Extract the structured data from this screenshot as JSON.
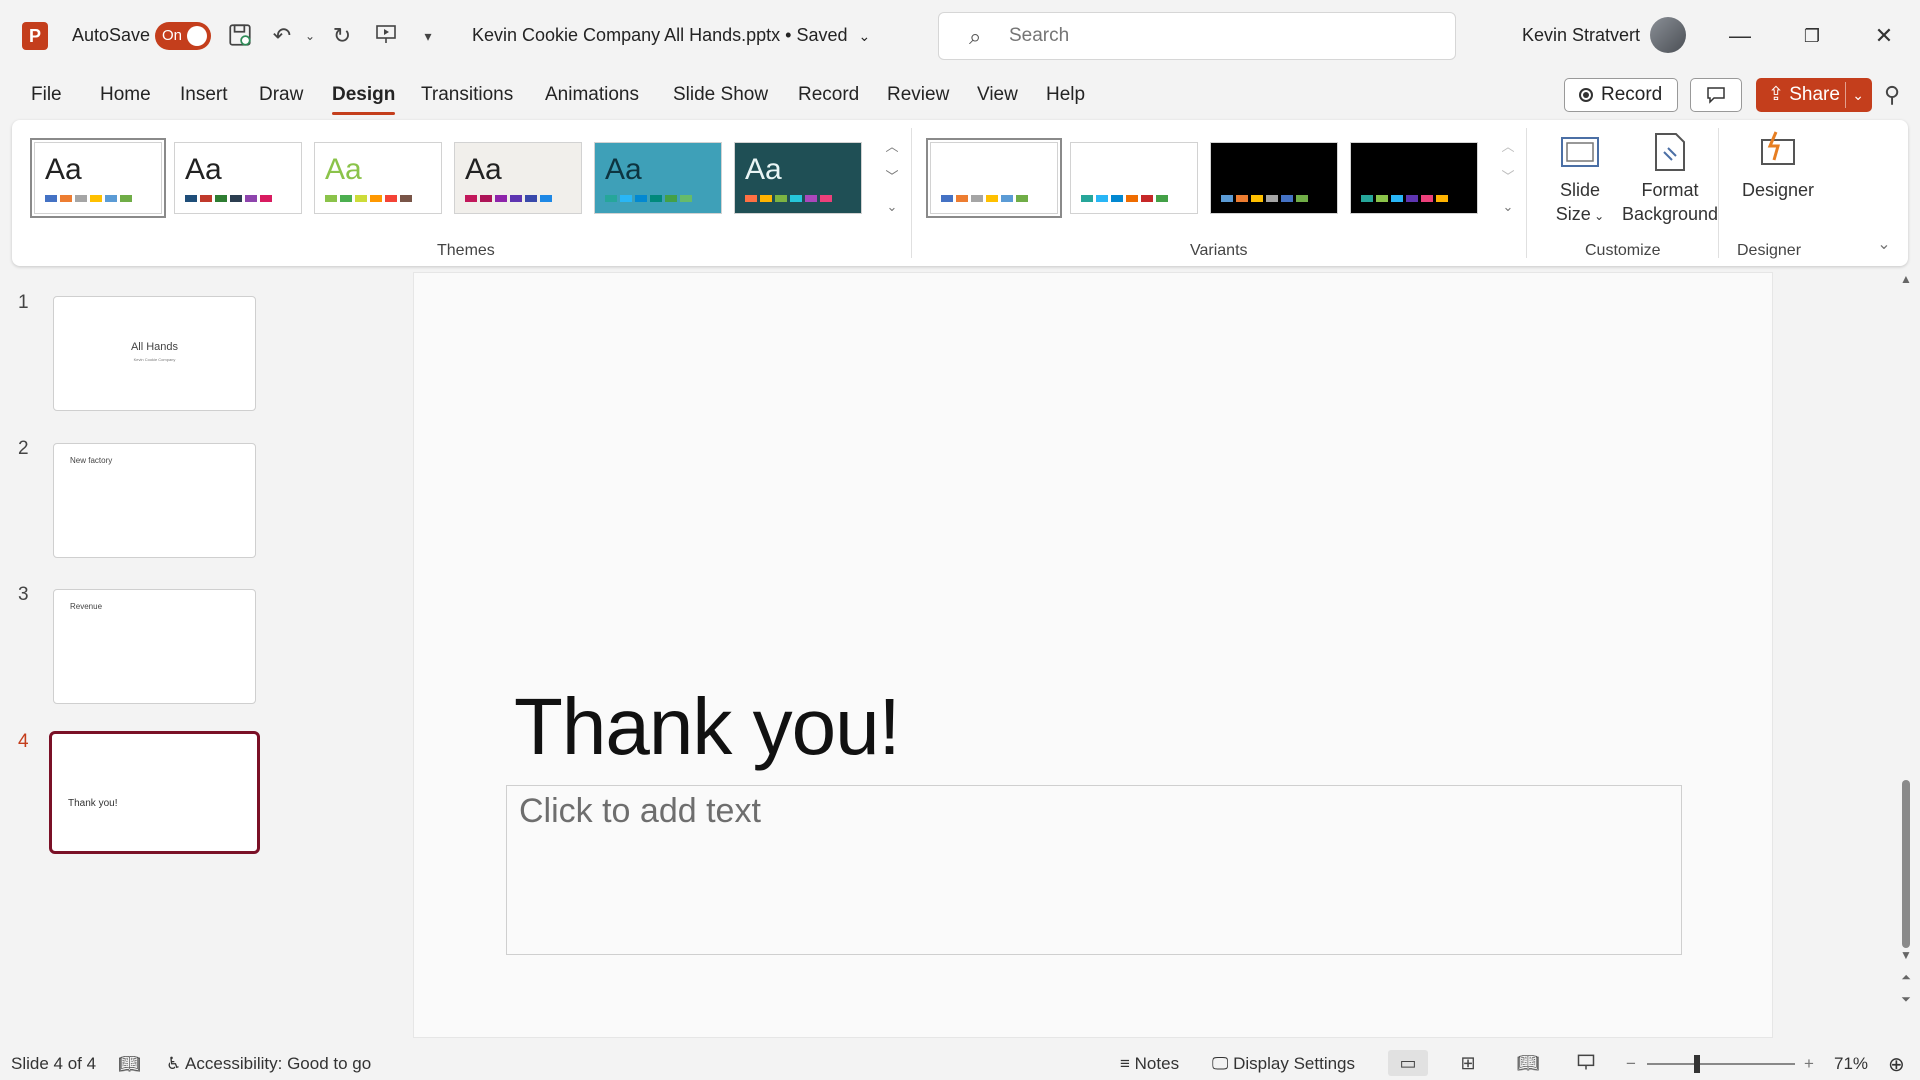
{
  "titlebar": {
    "app_logo": "P",
    "autosave_label": "AutoSave",
    "autosave_state": "On",
    "doc_title": "Kevin Cookie Company All Hands.pptx • Saved",
    "search_placeholder": "Search",
    "user_name": "Kevin Stratvert"
  },
  "menu": {
    "tabs": [
      "File",
      "Home",
      "Insert",
      "Draw",
      "Design",
      "Transitions",
      "Animations",
      "Slide Show",
      "Record",
      "Review",
      "View",
      "Help"
    ],
    "active_tab": "Design",
    "record_label": "Record",
    "share_label": "Share"
  },
  "ribbon": {
    "themes_label": "Themes",
    "variants_label": "Variants",
    "customize_label": "Customize",
    "designer_group_label": "Designer",
    "theme_sample_text": "Aa",
    "slide_size_label": [
      "Slide",
      "Size"
    ],
    "format_background_label": [
      "Format",
      "Background"
    ],
    "designer_label": "Designer",
    "themes": [
      {
        "bg": "#ffffff",
        "text": "#222222",
        "bars": [
          "#4472c4",
          "#ed7d31",
          "#a5a5a5",
          "#ffc000",
          "#5b9bd5",
          "#70ad47"
        ]
      },
      {
        "bg": "#ffffff",
        "text": "#222222",
        "bars": [
          "#1f4e79",
          "#c0392b",
          "#2e7d32",
          "#2c3e50",
          "#8e44ad",
          "#d81b60"
        ]
      },
      {
        "bg": "#ffffff",
        "text": "#8bc34a",
        "bars": [
          "#8bc34a",
          "#4caf50",
          "#cddc39",
          "#ff9800",
          "#f44336",
          "#795548"
        ]
      },
      {
        "bg": "#f1efeb",
        "text": "#222222",
        "bars": [
          "#c2185b",
          "#ad1457",
          "#8e24aa",
          "#5e35b1",
          "#3949ab",
          "#1e88e5"
        ]
      },
      {
        "bg": "#3ea0b8",
        "text": "#0d3440",
        "bars": [
          "#26a69a",
          "#29b6f6",
          "#0288d1",
          "#00897b",
          "#43a047",
          "#66bb6a"
        ]
      },
      {
        "bg": "#1f4f55",
        "text": "#e9f5f5",
        "bars": [
          "#ff7043",
          "#ffb300",
          "#7cb342",
          "#26c6da",
          "#ab47bc",
          "#ec407a"
        ]
      }
    ],
    "variants": [
      {
        "bg": "#ffffff",
        "bars": [
          "#4472c4",
          "#ed7d31",
          "#a5a5a5",
          "#ffc000",
          "#5b9bd5",
          "#70ad47"
        ]
      },
      {
        "bg": "#ffffff",
        "bars": [
          "#26a69a",
          "#29b6f6",
          "#0288d1",
          "#ef6c00",
          "#c62828",
          "#43a047"
        ]
      },
      {
        "bg": "#000000",
        "bars": [
          "#5b9bd5",
          "#ed7d31",
          "#ffc000",
          "#a5a5a5",
          "#4472c4",
          "#70ad47"
        ]
      },
      {
        "bg": "#000000",
        "bars": [
          "#26a69a",
          "#8bc34a",
          "#29b6f6",
          "#5e35b1",
          "#ec407a",
          "#ffb300"
        ]
      }
    ]
  },
  "slides_panel": {
    "slides": [
      {
        "number": "1",
        "title": "All Hands",
        "subtitle": "Kevin Cookie Company"
      },
      {
        "number": "2",
        "title": "New factory"
      },
      {
        "number": "3",
        "title": "Revenue"
      },
      {
        "number": "4",
        "title": "Thank you!"
      }
    ],
    "active_slide": "4"
  },
  "slide": {
    "title": "Thank you!",
    "body_placeholder": "Click to add text"
  },
  "statusbar": {
    "slide_position": "Slide 4 of 4",
    "accessibility": "Accessibility: Good to go",
    "notes_label": "Notes",
    "display_settings_label": "Display Settings",
    "zoom_level": "71%"
  },
  "colors": {
    "accent": "#c43e1c",
    "active_slide_border": "#7a1026"
  }
}
